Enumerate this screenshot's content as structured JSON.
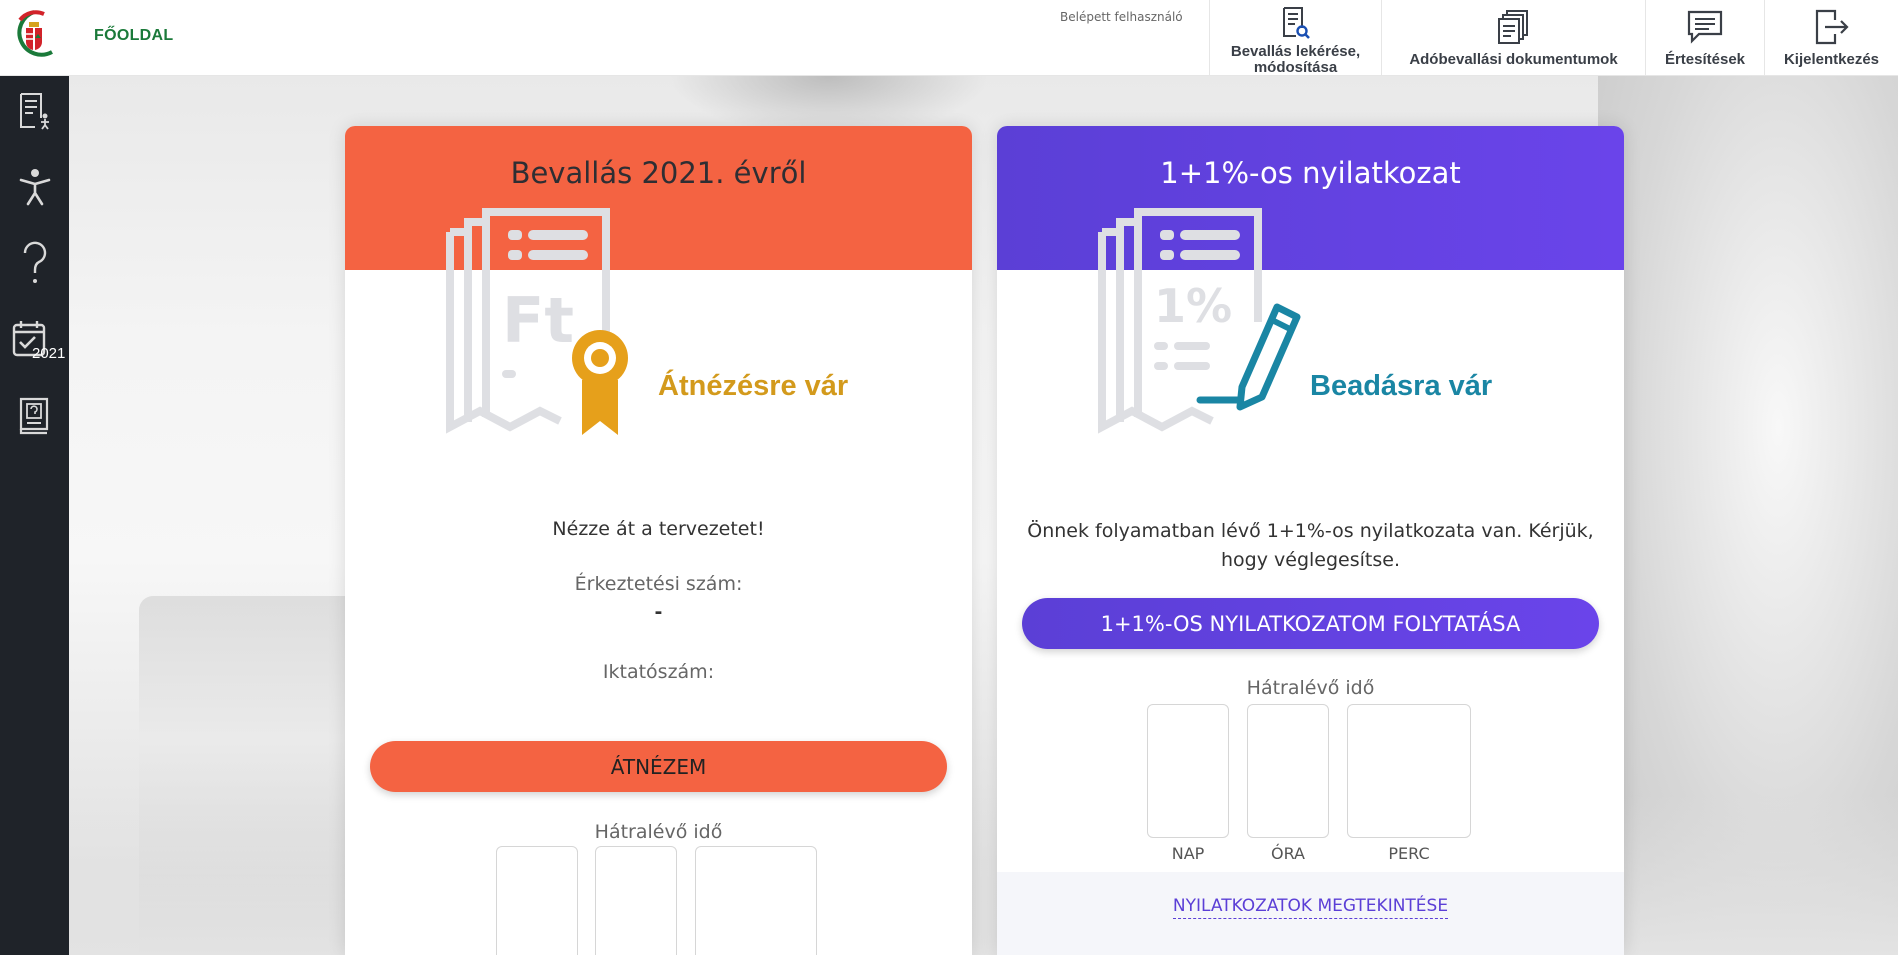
{
  "header": {
    "home_label": "FŐOLDAL",
    "user_label": "Belépett felhasználó",
    "nav": [
      {
        "label": "Bevallás lekérése,",
        "label2": "módosítása",
        "icon": "document-search-icon"
      },
      {
        "label": "Adóbevallási dokumentumok",
        "icon": "documents-stack-icon"
      },
      {
        "label": "Értesítések",
        "icon": "message-icon"
      },
      {
        "label": "Kijelentkezés",
        "icon": "logout-icon"
      }
    ]
  },
  "sidebar": {
    "items": [
      {
        "icon": "checklist-person-icon"
      },
      {
        "icon": "accessibility-icon"
      },
      {
        "icon": "help-question-icon"
      },
      {
        "icon": "calendar-check-icon",
        "year": "2021"
      },
      {
        "icon": "help-book-icon"
      }
    ]
  },
  "card_left": {
    "title": "Bevallás 2021. évről",
    "status": "Átnézésre vár",
    "instruction": "Nézze át a tervezetet!",
    "arrival_label": "Érkeztetési szám:",
    "arrival_value": "-",
    "filing_label": "Iktatószám:",
    "button": "ÁTNÉZEM",
    "remaining_label": "Hátralévő idő",
    "colors": {
      "head": "#f46342",
      "status": "#d39a1c"
    }
  },
  "card_right": {
    "title": "1+1%-os nyilatkozat",
    "status": "Beadásra vár",
    "message_line1": "Önnek folyamatban lévő 1+1%-os nyilatkozata van. Kérjük,",
    "message_line2": "hogy véglegesítse.",
    "button": "1+1%-OS NYILATKOZATOM FOLYTATÁSA",
    "remaining_label": "Hátralévő idő",
    "units": [
      "NAP",
      "ÓRA",
      "PERC"
    ],
    "footer_link": "NYILATKOZATOK MEGTEKINTÉSE",
    "colors": {
      "head": "#5b3fd6",
      "status": "#1a86a4"
    }
  }
}
